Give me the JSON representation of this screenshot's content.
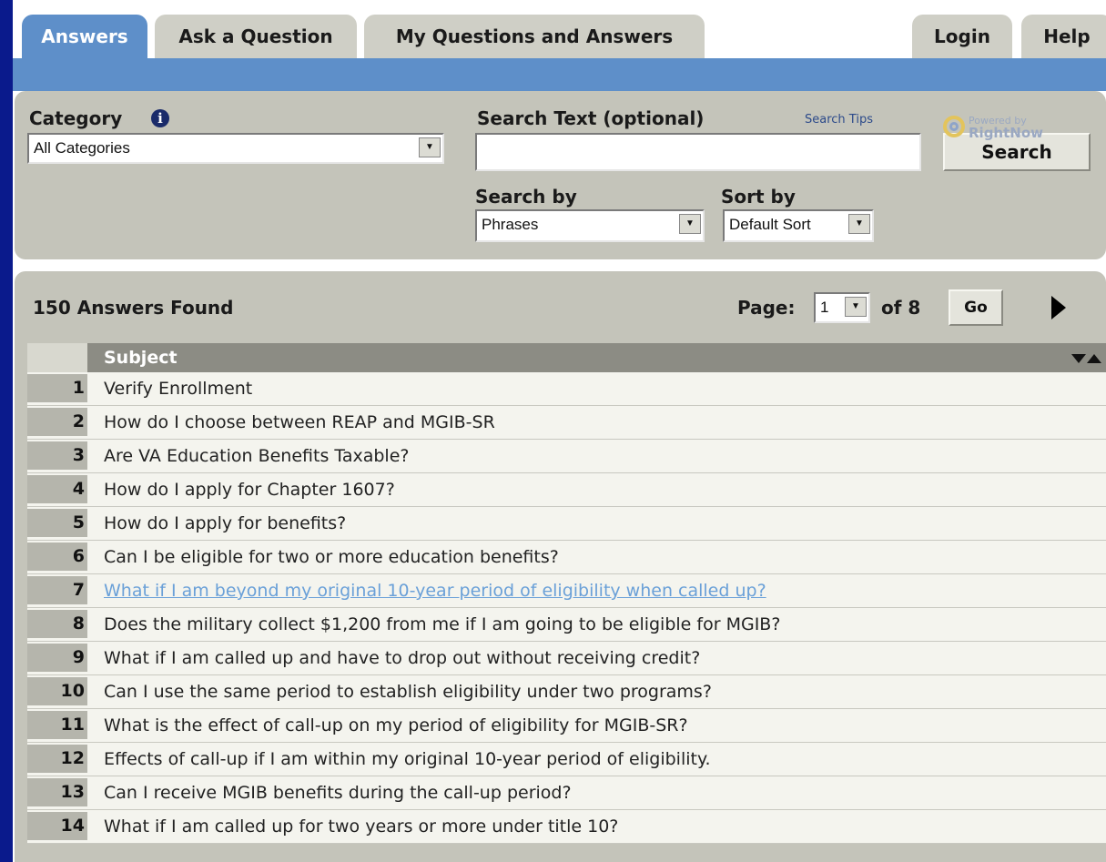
{
  "tabs": [
    {
      "label": "Answers",
      "active": true
    },
    {
      "label": "Ask a Question",
      "active": false
    },
    {
      "label": "My Questions and Answers",
      "active": false
    }
  ],
  "right_tabs": [
    {
      "label": "Login"
    },
    {
      "label": "Help"
    }
  ],
  "search": {
    "category_label": "Category",
    "category_value": "All Categories",
    "search_text_label": "Search Text (optional)",
    "search_tips": "Search Tips",
    "search_text_value": "",
    "search_button": "Search",
    "search_by_label": "Search by",
    "search_by_value": "Phrases",
    "sort_by_label": "Sort by",
    "sort_by_value": "Default Sort",
    "powered_line1": "Powered by",
    "powered_line2": "RightNow"
  },
  "results": {
    "count_text": "150 Answers Found",
    "page_label": "Page:",
    "page_value": "1",
    "of_text": "of 8",
    "go_button": "Go",
    "column_subject": "Subject",
    "rows": [
      {
        "n": "1",
        "q": "Verify Enrollment"
      },
      {
        "n": "2",
        "q": "How do I choose between REAP and MGIB-SR"
      },
      {
        "n": "3",
        "q": "Are VA Education Benefits Taxable?"
      },
      {
        "n": "4",
        "q": "How do I apply for Chapter 1607?"
      },
      {
        "n": "5",
        "q": "How do I apply for benefits?"
      },
      {
        "n": "6",
        "q": "Can I be eligible for two or more education benefits?"
      },
      {
        "n": "7",
        "q": "What if I am beyond my original 10-year period of eligibility when called up?",
        "visited": true
      },
      {
        "n": "8",
        "q": "Does the military collect $1,200 from me if I am going to be eligible for MGIB?"
      },
      {
        "n": "9",
        "q": "What if I am called up and have to drop out without receiving credit?"
      },
      {
        "n": "10",
        "q": "Can I use the same period to establish eligibility under two programs?"
      },
      {
        "n": "11",
        "q": "What is the effect of call-up on my period of eligibility for MGIB-SR?"
      },
      {
        "n": "12",
        "q": "Effects of call-up if I am within my original 10-year period of eligibility."
      },
      {
        "n": "13",
        "q": "Can I receive MGIB benefits during the call-up period?"
      },
      {
        "n": "14",
        "q": "What if I am called up for two years or more under title 10?"
      }
    ]
  },
  "colors": {
    "frame": "#0a1a8c",
    "tab_active": "#5e8fc9",
    "panel": "#c4c4ba",
    "visited_link": "#6aa0d8"
  }
}
